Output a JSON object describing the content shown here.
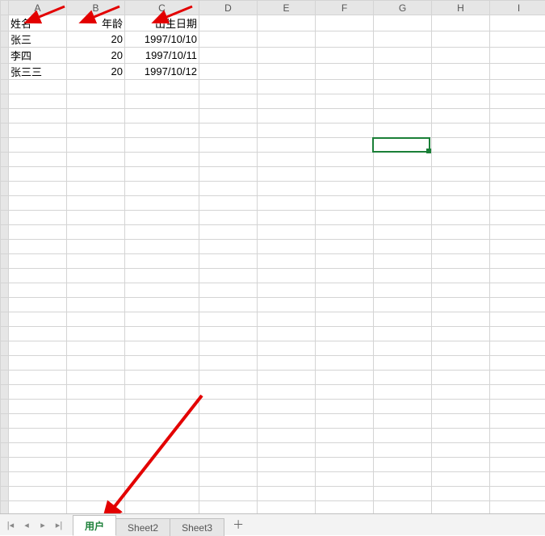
{
  "columns": [
    "A",
    "B",
    "C",
    "D",
    "E",
    "F",
    "G",
    "H",
    "I"
  ],
  "active_column": "G",
  "selection": {
    "col": "G",
    "row_index": 9
  },
  "headers": {
    "A": "姓名",
    "B": "年龄",
    "C": "出生日期"
  },
  "rows": [
    {
      "A": "张三",
      "B": "20",
      "C": "1997/10/10"
    },
    {
      "A": "李四",
      "B": "20",
      "C": "1997/10/11"
    },
    {
      "A": "张三三",
      "B": "20",
      "C": "1997/10/12"
    }
  ],
  "total_rows": 34,
  "tabs": {
    "items": [
      {
        "label": "用户",
        "active": true
      },
      {
        "label": "Sheet2",
        "active": false
      },
      {
        "label": "Sheet3",
        "active": false
      }
    ],
    "add_label": "＋",
    "nav": {
      "first": "|◂",
      "prev": "◂",
      "next": "▸",
      "last": "▸|"
    }
  },
  "annotations": {
    "arrow_to_A_header": true,
    "arrow_to_B_header": true,
    "arrow_to_C_header": true,
    "arrow_to_active_tab": true
  }
}
